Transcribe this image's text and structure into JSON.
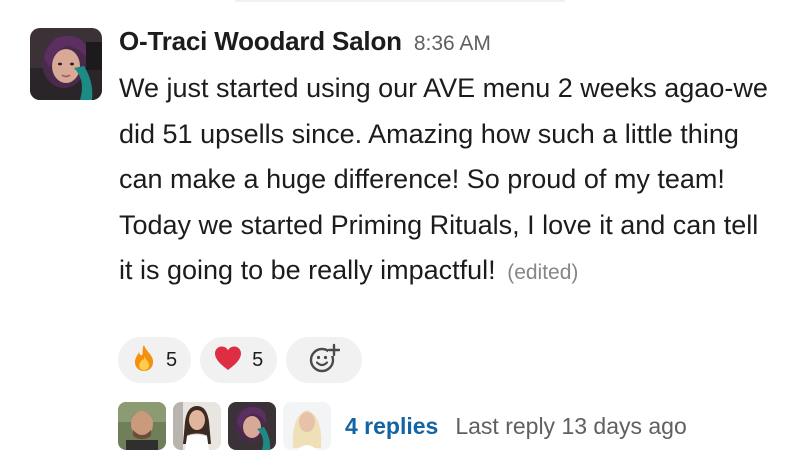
{
  "message": {
    "sender": "O-Traci Woodard Salon",
    "time": "8:36 AM",
    "text": "We just started using our AVE menu 2 weeks agao-we did 51 upsells since. Amazing how such a little thing can make a huge difference!  So proud of my team!  Today we started Priming Rituals, I love it and can tell it is going to be really impactful!",
    "edited_label": "(edited)"
  },
  "reactions": [
    {
      "icon": "fire-emoji-icon",
      "count": "5"
    },
    {
      "icon": "heart-emoji-icon",
      "count": "5"
    }
  ],
  "add_reaction": {
    "icon": "add-emoji-icon"
  },
  "thread": {
    "replies_label": "4 replies",
    "last_reply": "Last reply 13 days ago",
    "participants": 4
  },
  "colors": {
    "link": "#1264a3",
    "muted": "#616061",
    "reaction_bg": "#f1f1f1",
    "heart": "#dd2e44",
    "fire": "#f4900c"
  }
}
